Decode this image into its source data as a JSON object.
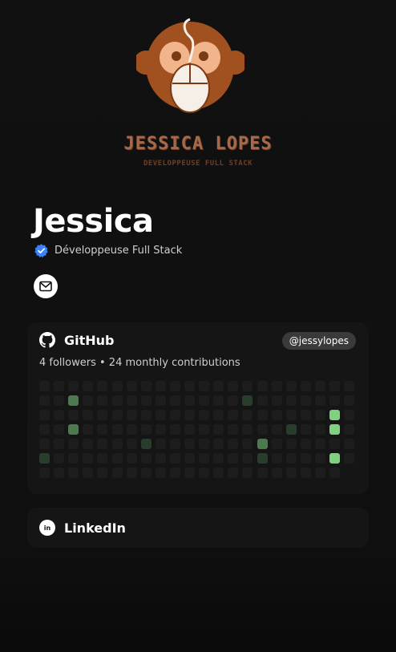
{
  "logo": {
    "title": "JESSICA LOPES",
    "subtitle": "DEVELOPPEUSE FULL STACK"
  },
  "profile": {
    "name": "Jessica",
    "headline": "Développeuse Full Stack"
  },
  "github": {
    "title": "GitHub",
    "handle": "@jessylopes",
    "stats": "4 followers • 24 monthly contributions",
    "grid": {
      "columns": 22,
      "rows": 7,
      "empty_color": "#1d1d1d",
      "levels": {
        "1": "#2a3d2c",
        "2": "#4a7a4e",
        "3": "#6fbf73",
        "4": "#7fd17f"
      },
      "active_cells": [
        {
          "col": 0,
          "row": 5,
          "level": 1
        },
        {
          "col": 2,
          "row": 1,
          "level": 2
        },
        {
          "col": 2,
          "row": 3,
          "level": 2
        },
        {
          "col": 7,
          "row": 4,
          "level": 1
        },
        {
          "col": 14,
          "row": 1,
          "level": 1
        },
        {
          "col": 15,
          "row": 4,
          "level": 2
        },
        {
          "col": 15,
          "row": 5,
          "level": 1
        },
        {
          "col": 17,
          "row": 3,
          "level": 1
        },
        {
          "col": 20,
          "row": 2,
          "level": 4
        },
        {
          "col": 20,
          "row": 3,
          "level": 4
        },
        {
          "col": 20,
          "row": 5,
          "level": 4
        }
      ],
      "missing_cells": [
        {
          "col": 21,
          "row": 6
        }
      ]
    }
  },
  "linkedin": {
    "title": "LinkedIn",
    "icon_text": "in"
  },
  "colors": {
    "background": "#0f0f0f",
    "card": "#151515",
    "brand_brown": "#a56a4a",
    "verified_blue": "#3b82f6"
  },
  "icons": {
    "verified": "verified-badge-icon",
    "mail": "mail-icon",
    "github": "github-icon",
    "linkedin": "linkedin-icon"
  }
}
